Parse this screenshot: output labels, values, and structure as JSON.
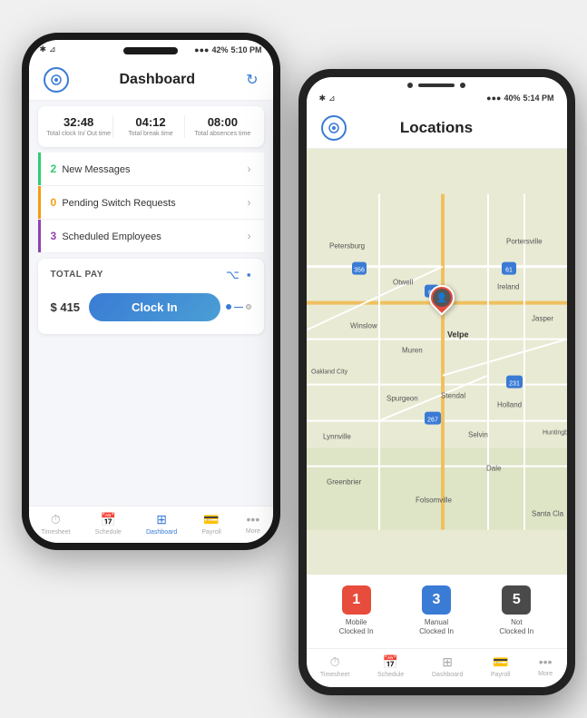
{
  "phone1": {
    "status_bar": {
      "time": "5:10 PM",
      "battery": "42%",
      "signal": "●●●"
    },
    "header": {
      "title": "Dashboard",
      "refresh_label": "refresh"
    },
    "stats": [
      {
        "value": "32:48",
        "label": "Total clock In/ Out time"
      },
      {
        "value": "04:12",
        "label": "Total break time"
      },
      {
        "value": "08:00",
        "label": "Total absences time"
      }
    ],
    "menu_items": [
      {
        "number": "2",
        "label": "New Messages",
        "color": "green"
      },
      {
        "number": "0",
        "label": "Pending Switch Requests",
        "color": "yellow"
      },
      {
        "number": "3",
        "label": "Scheduled Employees",
        "color": "purple"
      }
    ],
    "total_pay": {
      "label": "TOTAL PAY",
      "amount": "$ 415",
      "clock_in_label": "Clock In"
    },
    "bottom_nav": [
      {
        "label": "Timesheet",
        "icon": "⏱",
        "active": false
      },
      {
        "label": "Schedule",
        "icon": "📅",
        "active": false
      },
      {
        "label": "Dashboard",
        "icon": "⊞",
        "active": true
      },
      {
        "label": "Payroll",
        "icon": "💳",
        "active": false
      },
      {
        "label": "More",
        "icon": "•••",
        "active": false
      }
    ]
  },
  "phone2": {
    "status_bar": {
      "time": "5:14 PM",
      "battery": "40%",
      "signal": "●●●"
    },
    "header": {
      "title": "Locations"
    },
    "location_stats": [
      {
        "number": "1",
        "label": "Mobile\nClocked In",
        "color": "red"
      },
      {
        "number": "3",
        "label": "Manual\nClocked In",
        "color": "blue"
      },
      {
        "number": "5",
        "label": "Not\nClocked In",
        "color": "dark"
      }
    ],
    "bottom_nav": [
      {
        "label": "Timesheet",
        "icon": "⏱",
        "active": false
      },
      {
        "label": "Schedule",
        "icon": "📅",
        "active": false
      },
      {
        "label": "Dashboard",
        "icon": "⊞",
        "active": false
      },
      {
        "label": "Payroll",
        "icon": "💳",
        "active": false
      },
      {
        "label": "More",
        "icon": "•••",
        "active": false
      }
    ],
    "map": {
      "places": [
        "Petersburg",
        "Portersville",
        "Otwell",
        "Ireland",
        "Jasper",
        "Winslow",
        "Velpe",
        "Muren",
        "Oakland City",
        "Stendal",
        "Holland",
        "Lynnville",
        "Selvin",
        "Dale",
        "Greenbrier",
        "Folsomville",
        "Santa Cla"
      ]
    }
  }
}
